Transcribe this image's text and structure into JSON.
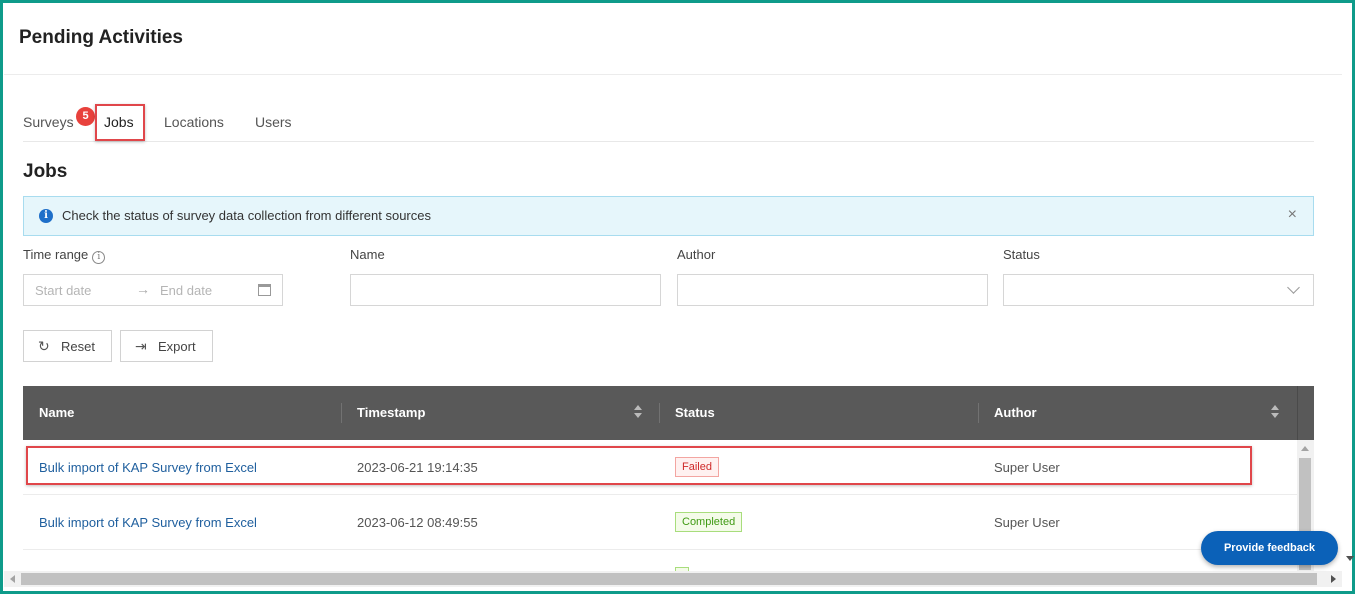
{
  "page": {
    "title": "Pending Activities"
  },
  "tabs": [
    {
      "label": "Surveys"
    },
    {
      "label": "Jobs",
      "active": true
    },
    {
      "label": "Locations"
    },
    {
      "label": "Users"
    }
  ],
  "badge": {
    "count": "5",
    "color": "#e8413c"
  },
  "section": {
    "title": "Jobs"
  },
  "alert": {
    "text": "Check the status of survey data collection from different sources",
    "icon": "info-icon",
    "close_icon": "close-icon"
  },
  "filters": {
    "time_range_label": "Time range",
    "start_placeholder": "Start date",
    "end_placeholder": "End date",
    "name_label": "Name",
    "author_label": "Author",
    "status_label": "Status",
    "name_value": "",
    "author_value": "",
    "status_value": ""
  },
  "buttons": {
    "reset": "Reset",
    "export": "Export"
  },
  "table": {
    "columns": [
      "Name",
      "Timestamp",
      "Status",
      "Author"
    ],
    "rows": [
      {
        "name": "Bulk import of KAP Survey from Excel",
        "timestamp": "2023-06-21 19:14:35",
        "status": "Failed",
        "author": "Super User"
      },
      {
        "name": "Bulk import of KAP Survey from Excel",
        "timestamp": "2023-06-12 08:49:55",
        "status": "Completed",
        "author": "Super User"
      }
    ]
  },
  "feedback": {
    "label": "Provide feedback"
  },
  "colors": {
    "frame": "#0e9b8a",
    "highlight": "#e0464a",
    "accent": "#0b61b8",
    "header": "#595959"
  }
}
